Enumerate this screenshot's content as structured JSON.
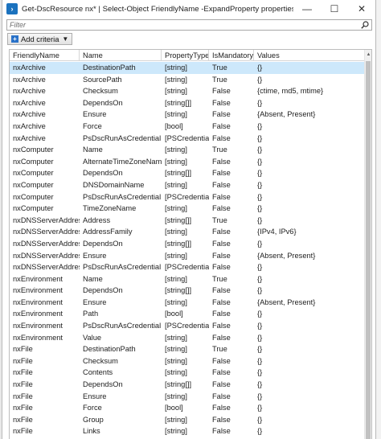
{
  "window": {
    "title": "Get-DscResource nx* | Select-Object FriendlyName -ExpandProperty properties | Out-GridVi...",
    "minimize": "—",
    "maximize": "☐",
    "close": "✕"
  },
  "filter": {
    "placeholder": "Filter"
  },
  "criteria_button": {
    "label": "Add criteria"
  },
  "columns": [
    "FriendlyName",
    "Name",
    "PropertyType",
    "IsMandatory",
    "Values"
  ],
  "rows": [
    [
      "nxArchive",
      "DestinationPath",
      "[string]",
      "True",
      "{}"
    ],
    [
      "nxArchive",
      "SourcePath",
      "[string]",
      "True",
      "{}"
    ],
    [
      "nxArchive",
      "Checksum",
      "[string]",
      "False",
      "{ctime, md5, mtime}"
    ],
    [
      "nxArchive",
      "DependsOn",
      "[string[]]",
      "False",
      "{}"
    ],
    [
      "nxArchive",
      "Ensure",
      "[string]",
      "False",
      "{Absent, Present}"
    ],
    [
      "nxArchive",
      "Force",
      "[bool]",
      "False",
      "{}"
    ],
    [
      "nxArchive",
      "PsDscRunAsCredential",
      "[PSCredential]",
      "False",
      "{}"
    ],
    [
      "nxComputer",
      "Name",
      "[string]",
      "True",
      "{}"
    ],
    [
      "nxComputer",
      "AlternateTimeZoneName",
      "[string]",
      "False",
      "{}"
    ],
    [
      "nxComputer",
      "DependsOn",
      "[string[]]",
      "False",
      "{}"
    ],
    [
      "nxComputer",
      "DNSDomainName",
      "[string]",
      "False",
      "{}"
    ],
    [
      "nxComputer",
      "PsDscRunAsCredential",
      "[PSCredential]",
      "False",
      "{}"
    ],
    [
      "nxComputer",
      "TimeZoneName",
      "[string]",
      "False",
      "{}"
    ],
    [
      "nxDNSServerAddress",
      "Address",
      "[string[]]",
      "True",
      "{}"
    ],
    [
      "nxDNSServerAddress",
      "AddressFamily",
      "[string]",
      "False",
      "{IPv4, IPv6}"
    ],
    [
      "nxDNSServerAddress",
      "DependsOn",
      "[string[]]",
      "False",
      "{}"
    ],
    [
      "nxDNSServerAddress",
      "Ensure",
      "[string]",
      "False",
      "{Absent, Present}"
    ],
    [
      "nxDNSServerAddress",
      "PsDscRunAsCredential",
      "[PSCredential]",
      "False",
      "{}"
    ],
    [
      "nxEnvironment",
      "Name",
      "[string]",
      "True",
      "{}"
    ],
    [
      "nxEnvironment",
      "DependsOn",
      "[string[]]",
      "False",
      "{}"
    ],
    [
      "nxEnvironment",
      "Ensure",
      "[string]",
      "False",
      "{Absent, Present}"
    ],
    [
      "nxEnvironment",
      "Path",
      "[bool]",
      "False",
      "{}"
    ],
    [
      "nxEnvironment",
      "PsDscRunAsCredential",
      "[PSCredential]",
      "False",
      "{}"
    ],
    [
      "nxEnvironment",
      "Value",
      "[string]",
      "False",
      "{}"
    ],
    [
      "nxFile",
      "DestinationPath",
      "[string]",
      "True",
      "{}"
    ],
    [
      "nxFile",
      "Checksum",
      "[string]",
      "False",
      "{}"
    ],
    [
      "nxFile",
      "Contents",
      "[string]",
      "False",
      "{}"
    ],
    [
      "nxFile",
      "DependsOn",
      "[string[]]",
      "False",
      "{}"
    ],
    [
      "nxFile",
      "Ensure",
      "[string]",
      "False",
      "{}"
    ],
    [
      "nxFile",
      "Force",
      "[bool]",
      "False",
      "{}"
    ],
    [
      "nxFile",
      "Group",
      "[string]",
      "False",
      "{}"
    ],
    [
      "nxFile",
      "Links",
      "[string]",
      "False",
      "{}"
    ]
  ],
  "selected_row": 0,
  "colors": {
    "selection": "#cde8fb",
    "accent": "#1b72be"
  }
}
